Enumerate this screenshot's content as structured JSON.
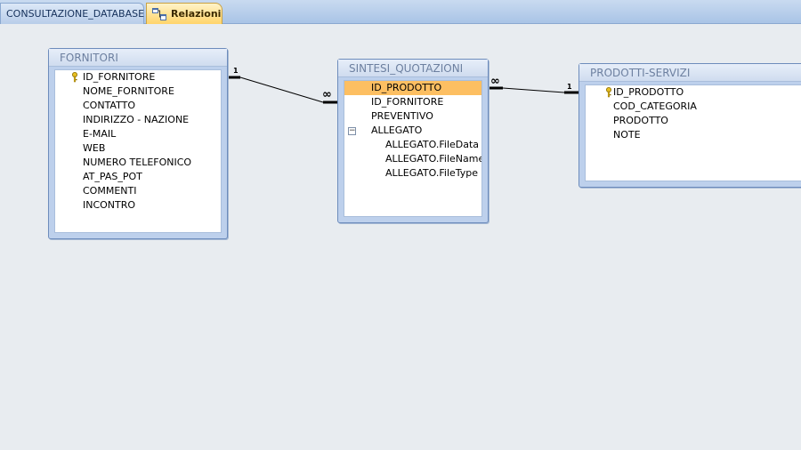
{
  "tabs": [
    {
      "label": "CONSULTAZIONE_DATABASE",
      "active": false
    },
    {
      "label": "Relazioni",
      "active": true,
      "icon": "relationships-icon"
    }
  ],
  "tables": {
    "fornitori": {
      "title": "FORNITORI",
      "fields": [
        "ID_FORNITORE",
        "NOME_FORNITORE",
        "CONTATTO",
        "INDIRIZZO - NAZIONE",
        "E-MAIL",
        "WEB",
        "NUMERO TELEFONICO",
        "AT_PAS_POT",
        "COMMENTI",
        "INCONTRO"
      ],
      "primary_key": "ID_FORNITORE"
    },
    "sintesi": {
      "title": "SINTESI_QUOTAZIONI",
      "fields": [
        "ID_PRODOTTO",
        "ID_FORNITORE",
        "PREVENTIVO",
        "ALLEGATO",
        "ALLEGATO.FileData",
        "ALLEGATO.FileName",
        "ALLEGATO.FileType"
      ],
      "selected_field": "ID_PRODOTTO",
      "expand_toggle": "−"
    },
    "prodotti": {
      "title": "PRODOTTI-SERVIZI",
      "fields": [
        "ID_PRODOTTO",
        "COD_CATEGORIA",
        "PRODOTTO",
        "NOTE"
      ],
      "primary_key": "ID_PRODOTTO"
    }
  },
  "relationships": [
    {
      "from": "FORNITORI.ID_FORNITORE",
      "to": "SINTESI_QUOTAZIONI.ID_FORNITORE",
      "from_cardinality": "1",
      "to_cardinality": "∞"
    },
    {
      "from": "SINTESI_QUOTAZIONI.ID_PRODOTTO",
      "to": "PRODOTTI-SERVIZI.ID_PRODOTTO",
      "from_cardinality": "∞",
      "to_cardinality": "1"
    }
  ],
  "colors": {
    "selection": "#fdbf62",
    "active_tab": "#ffd46a",
    "key": "#c8a000"
  }
}
